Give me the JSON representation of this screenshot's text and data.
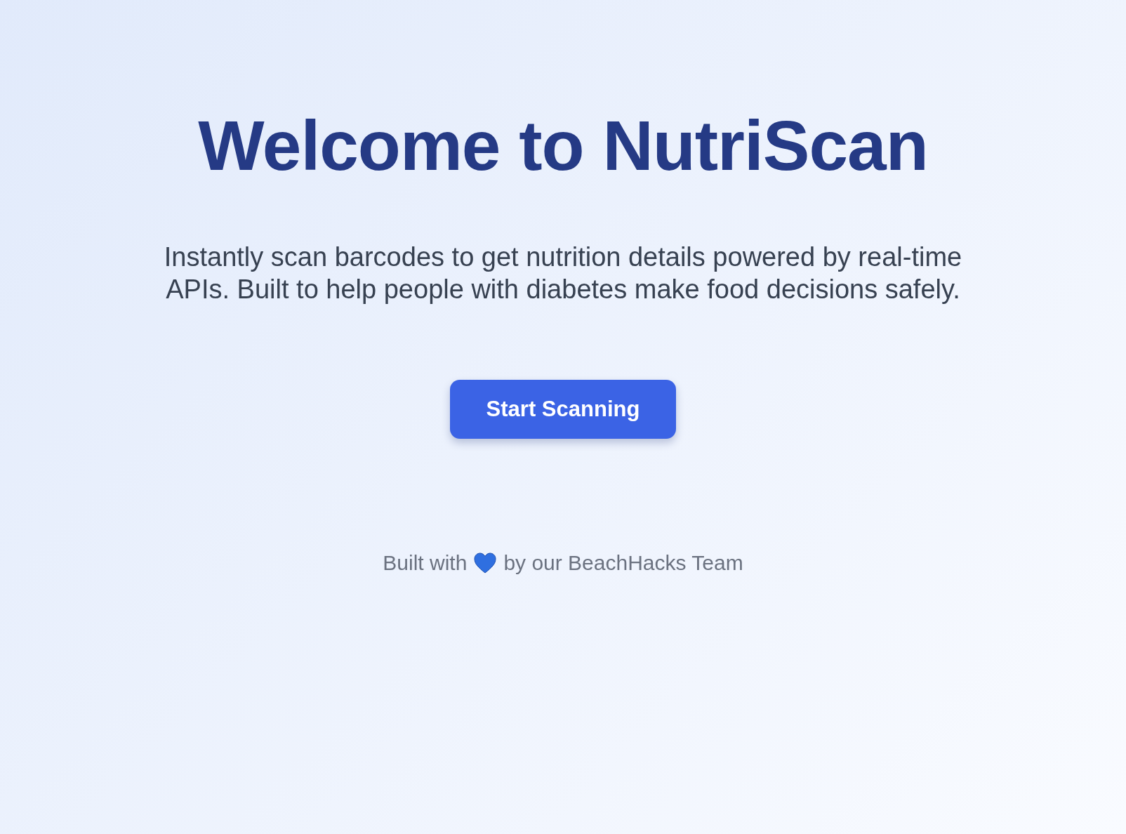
{
  "title": "Welcome to NutriScan",
  "description": "Instantly scan barcodes to get nutrition details powered by real-time APIs. Built to help people with diabetes make food decisions safely.",
  "primary_button": {
    "label": "Start Scanning"
  },
  "footer": {
    "before_icon": "Built with",
    "after_icon": "by our BeachHacks Team"
  }
}
